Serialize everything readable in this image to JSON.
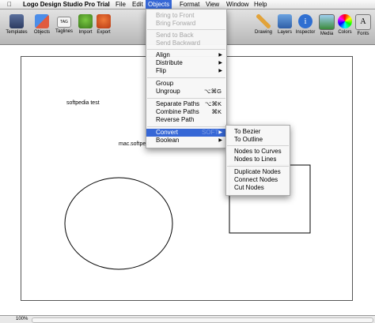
{
  "menubar": {
    "app_name": "Logo Design Studio Pro Trial",
    "menus": [
      "File",
      "Edit",
      "Objects",
      "Format",
      "View",
      "Window",
      "Help"
    ]
  },
  "toolbar": {
    "left": [
      "Templates",
      "Objects",
      "Taglines",
      "Import",
      "Export"
    ],
    "right": [
      "Drawing",
      "Layers",
      "Inspector",
      "Media",
      "Colors",
      "Fonts"
    ]
  },
  "canvas": {
    "text1": "softpedia test",
    "text2": "mac.softped"
  },
  "objects_menu": {
    "bring_to_front": "Bring to Front",
    "bring_forward": "Bring Forward",
    "send_to_back": "Send to Back",
    "send_backward": "Send Backward",
    "align": "Align",
    "distribute": "Distribute",
    "flip": "Flip",
    "group": "Group",
    "ungroup": "Ungroup",
    "ungroup_shortcut": "⌥⌘G",
    "separate_paths": "Separate Paths",
    "separate_paths_shortcut": "⌥⌘K",
    "combine_paths": "Combine Paths",
    "combine_paths_shortcut": "⌘K",
    "reverse_path": "Reverse Path",
    "convert": "Convert",
    "boolean": "Boolean",
    "watermark": "SOFT"
  },
  "convert_submenu": {
    "to_bezier": "To Bezier",
    "to_outline": "To Outline",
    "nodes_to_curves": "Nodes to Curves",
    "nodes_to_lines": "Nodes to Lines",
    "duplicate_nodes": "Duplicate Nodes",
    "connect_nodes": "Connect Nodes",
    "cut_nodes": "Cut Nodes"
  },
  "status": {
    "zoom": "100%"
  },
  "colors": {
    "highlight": "#3667d6"
  }
}
